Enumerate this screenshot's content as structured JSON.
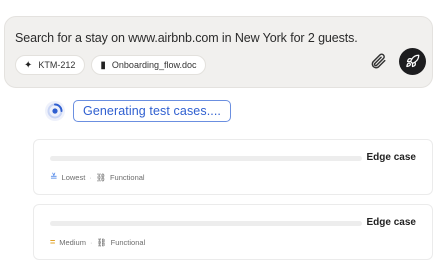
{
  "prompt": {
    "text": "Search for a stay on www.airbnb.com in New York for 2 guests.",
    "chips": [
      {
        "icon": "jira-icon",
        "label": "KTM-212"
      },
      {
        "icon": "document-icon",
        "label": "Onboarding_flow.doc"
      }
    ],
    "attach_icon": "paperclip-icon",
    "send_icon": "rocket-icon"
  },
  "status": {
    "label": "Generating test cases...."
  },
  "cases": [
    {
      "type": "Edge case",
      "priority": "Lowest",
      "category": "Functional"
    },
    {
      "type": "Edge case",
      "priority": "Medium",
      "category": "Functional"
    }
  ],
  "colors": {
    "accent": "#2f5fd0",
    "send_button": "#1d1d1f",
    "priority_lowest": "#3a78e6",
    "priority_medium": "#e0a32a"
  }
}
